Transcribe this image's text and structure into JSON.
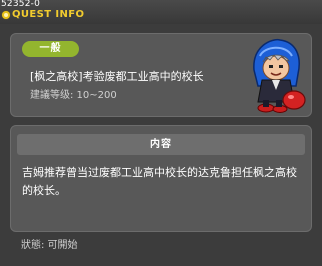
{
  "window": {
    "quest_id": "52352-0",
    "title": "QUEST INFO"
  },
  "quest": {
    "category": "一般",
    "title": "[枫之高校]考验废都工业高中的校长",
    "level_requirement": "建議等级: 10~200"
  },
  "content": {
    "header": "内容",
    "description": "吉姆推荐曾当过废都工业高中校长的达克鲁担任枫之高校的校长。"
  },
  "status": "狀態: 可開始",
  "colors": {
    "title_text": "#f2cc2e",
    "category_badge": "#93b52e",
    "panel": "#585858",
    "window_bg": "#3c3c3c"
  },
  "icons": {
    "title_icon": "quest-marker-icon",
    "npc": "npc-portrait"
  }
}
